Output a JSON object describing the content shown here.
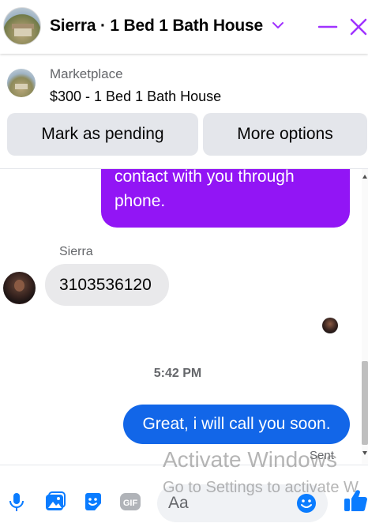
{
  "header": {
    "title": "Sierra · 1 Bed 1 Bath House",
    "accent": "#a033ff"
  },
  "marketplace": {
    "label": "Marketplace",
    "item": "$300 - 1 Bed 1 Bath House",
    "buttons": {
      "mark_pending": "Mark as pending",
      "more_options": "More options"
    }
  },
  "messages": {
    "outgoing_partial": "contact with you through phone.",
    "sender_name": "Sierra",
    "incoming": "3103536120",
    "timestamp": "5:42 PM",
    "outgoing_last": "Great, i will call you soon.",
    "status": "Sent",
    "colors": {
      "outgoing_purple": "#9215f5",
      "outgoing_blue": "#1266e8",
      "incoming_bg": "#e9e9eb"
    }
  },
  "composer": {
    "placeholder": "Aa",
    "icons": [
      "microphone-icon",
      "photo-icon",
      "sticker-icon",
      "gif-icon",
      "emoji-icon",
      "thumbs-up-icon"
    ],
    "accent": "#0a7cff"
  },
  "watermark": {
    "line1": "Activate Windows",
    "line2": "Go to Settings to activate W"
  }
}
